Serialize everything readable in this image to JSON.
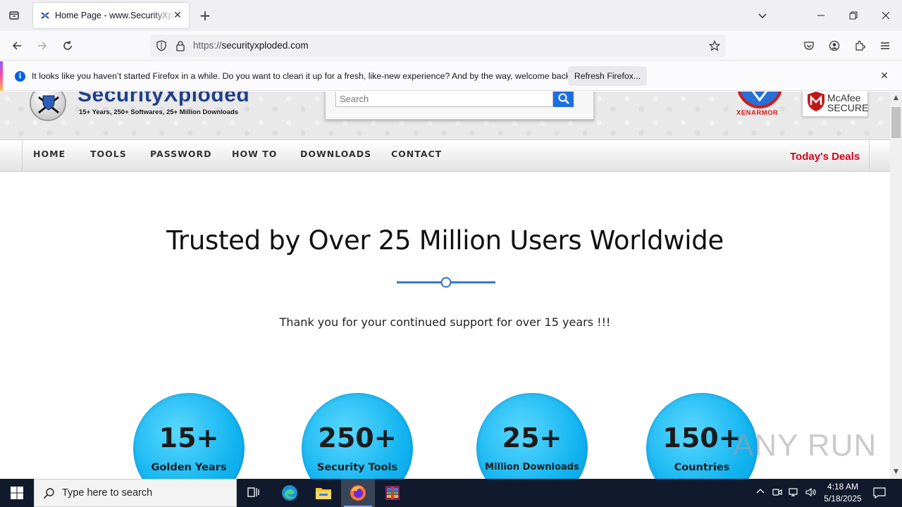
{
  "browser": {
    "tab": {
      "title": "Home Page - www.SecurityXploded.com"
    },
    "url": {
      "scheme": "https://",
      "host": "securityxploded.com"
    },
    "notification": {
      "message": "It looks like you haven’t started Firefox in a while. Do you want to clean it up for a fresh, like-new experience? And by the way, welcome back!",
      "button": "Refresh Firefox..."
    }
  },
  "site": {
    "logo_text": "SecurityXploded",
    "tagline": "15+ Years, 250+ Softwares, 25+ Million Downloads",
    "search_placeholder": "Search",
    "partner_xen": "XENARMOR",
    "partner_mcafee_line1": "McAfee",
    "partner_mcafee_line2": "SECURE",
    "nav": [
      "HOME",
      "TOOLS",
      "PASSWORD",
      "HOW TO",
      "DOWNLOADS",
      "CONTACT"
    ],
    "deals": "Today's Deals",
    "headline": "Trusted by Over 25 Million Users Worldwide",
    "thanks": "Thank you for your continued support for over 15 years !!!",
    "stats": [
      {
        "num": "15+",
        "label": "Golden Years"
      },
      {
        "num": "250+",
        "label": "Security Tools"
      },
      {
        "num": "25+",
        "label": "Million Downloads"
      },
      {
        "num": "150+",
        "label": "Countries"
      }
    ]
  },
  "watermark": "ANY RUN",
  "taskbar": {
    "search_placeholder": "Type here to search",
    "time": "4:18 AM",
    "date": "5/18/2025"
  }
}
